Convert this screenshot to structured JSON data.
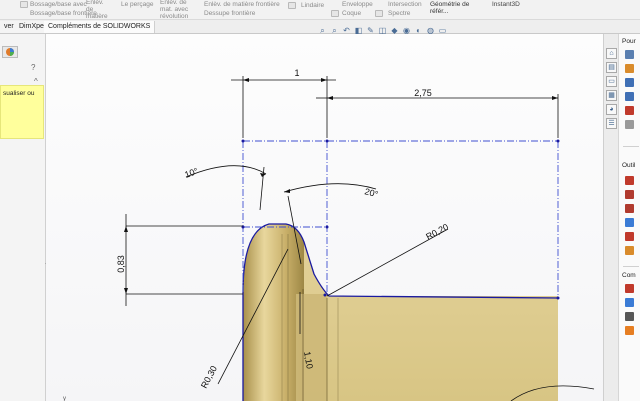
{
  "ribbon": {
    "items": [
      "Bossage/base avec",
      "Bossage/base frontière",
      "Enlèv. de matière extrudé",
      "Le perçage",
      "Enlèv. de mat. avec révolution",
      "Enlèv. de matière frontière",
      "Dessupe frontière",
      "Lindaire",
      "Coque",
      "Enveloppe",
      "Intersection",
      "Spectre",
      "Géométrie de référ...",
      "Instant3D"
    ]
  },
  "tabs": [
    "ver",
    "DimXpert",
    "Compléments de SOLIDWORKS"
  ],
  "left_panel": {
    "help_symbol": "?",
    "collapse_symbol": "^",
    "message": "sualiser ou",
    "splitter_symbol": "◂"
  },
  "drawing": {
    "dimensions": {
      "width_top": "1",
      "width_long": "2,75",
      "angle_left": "10°",
      "angle_right": "20°",
      "radius_fillet": "R0,20",
      "height": "0,83",
      "radius_bottom": "R0,30",
      "small_dim": "1,10"
    },
    "axis_label": "y",
    "colors": {
      "outline": "#1a1aa0",
      "centerline": "#3f4fd0",
      "dimension": "#111111",
      "face": "#d9c78a"
    }
  },
  "right_pane": {
    "sections": [
      "Pour",
      "Outil",
      "Com"
    ]
  }
}
